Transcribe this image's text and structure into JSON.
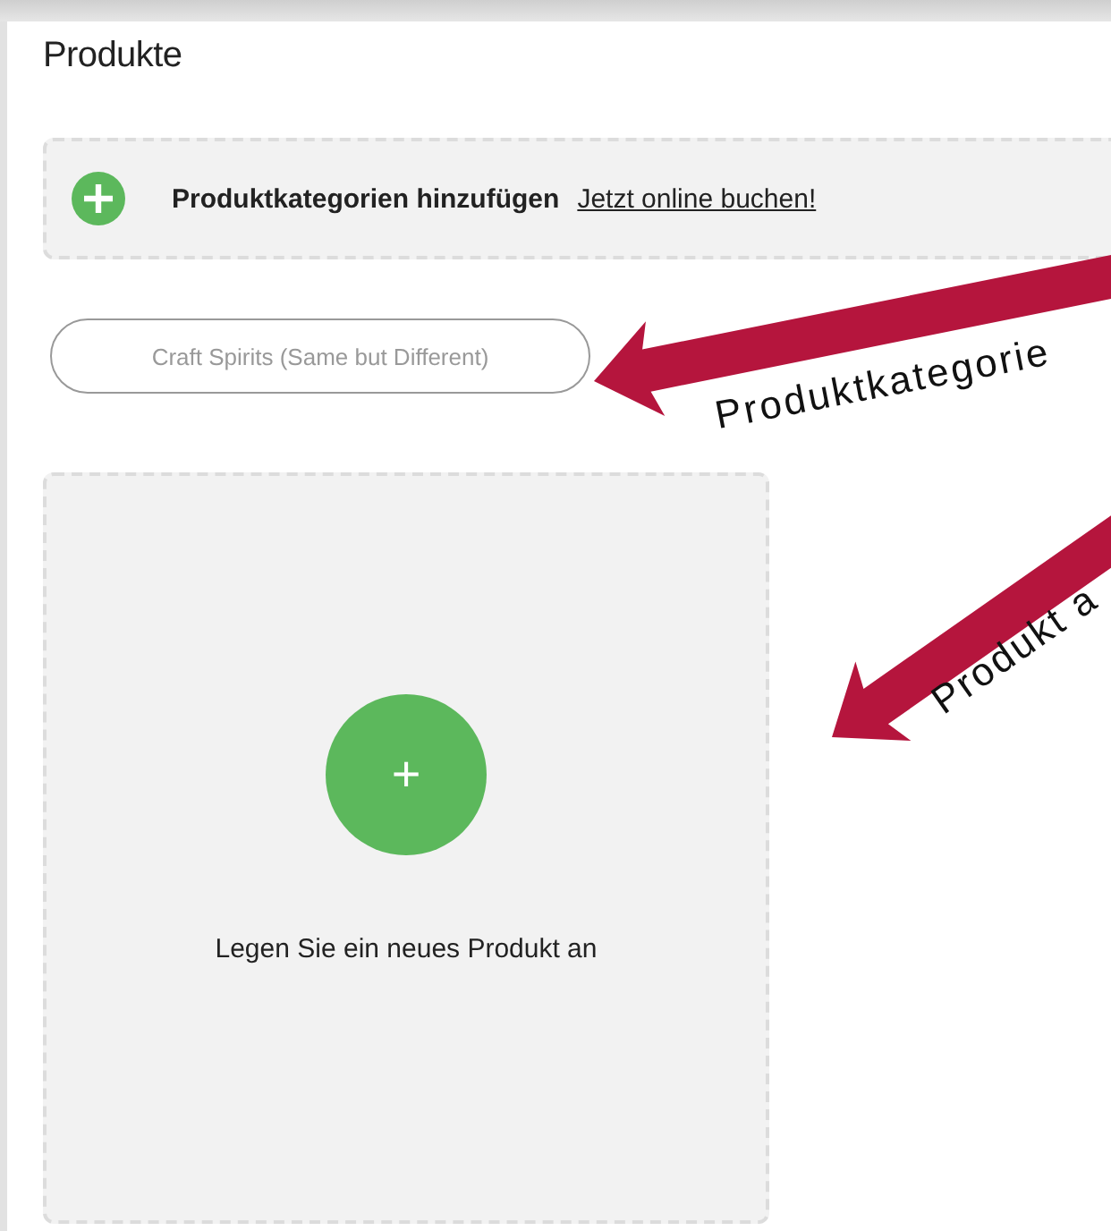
{
  "page": {
    "title": "Produkte"
  },
  "banner": {
    "label": "Produktkategorien hinzufügen",
    "link": "Jetzt online buchen!"
  },
  "category_tag": "Craft Spirits (Same but Different)",
  "new_product_card": {
    "button": "+",
    "label": "Legen Sie ein neues Produkt an"
  },
  "annotations": [
    {
      "text": "Produktkategorie"
    },
    {
      "text": "Produkt a"
    }
  ]
}
